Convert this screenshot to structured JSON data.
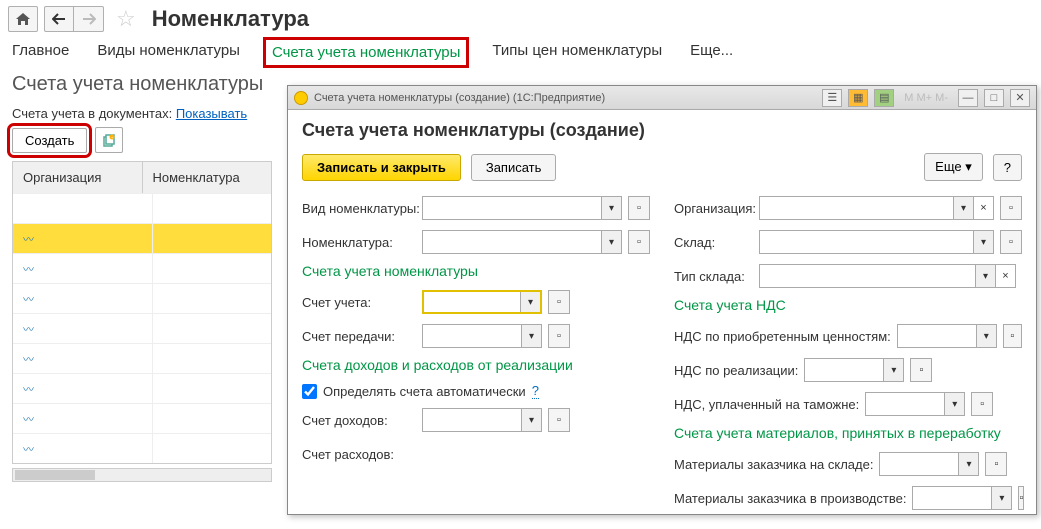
{
  "header": {
    "page_title": "Номенклатура"
  },
  "tabs": {
    "main": "Главное",
    "types": "Виды номенклатуры",
    "accounts": "Счета учета номенклатуры",
    "price_types": "Типы цен номенклатуры",
    "more": "Еще..."
  },
  "sub_title": "Счета учета номенклатуры",
  "show_line": {
    "prefix": "Счета учета в документах: ",
    "link": "Показывать"
  },
  "create_btn": "Создать",
  "grid": {
    "col_org": "Организация",
    "col_nom": "Номенклатура"
  },
  "dialog": {
    "window_title": "Счета учета номенклатуры (создание)  (1С:Предприятие)",
    "heading": "Счета учета номенклатуры (создание)",
    "btn_save_close": "Записать и закрыть",
    "btn_save": "Записать",
    "btn_more": "Еще",
    "btn_help": "?",
    "labels": {
      "nom_type": "Вид номенклатуры:",
      "nomenclature": "Номенклатура:",
      "org": "Организация:",
      "warehouse": "Склад:",
      "warehouse_type": "Тип склада:"
    },
    "section_accounts": "Счета учета номенклатуры",
    "acct_label": "Счет учета:",
    "transfer_label": "Счет передачи:",
    "section_vat": "Счета учета НДС",
    "vat_acq": "НДС по приобретенным ценностям:",
    "vat_real": "НДС по реализации:",
    "vat_customs": "НДС, уплаченный на таможне:",
    "section_income": "Счета доходов и расходов от реализации",
    "auto_check": "Определять счета автоматически",
    "income_label": "Счет доходов:",
    "expense_label": "Счет расходов:",
    "section_materials": "Счета учета материалов, принятых в переработку",
    "mat_wh": "Материалы заказчика на складе:",
    "mat_prod": "Материалы заказчика в производстве:"
  }
}
